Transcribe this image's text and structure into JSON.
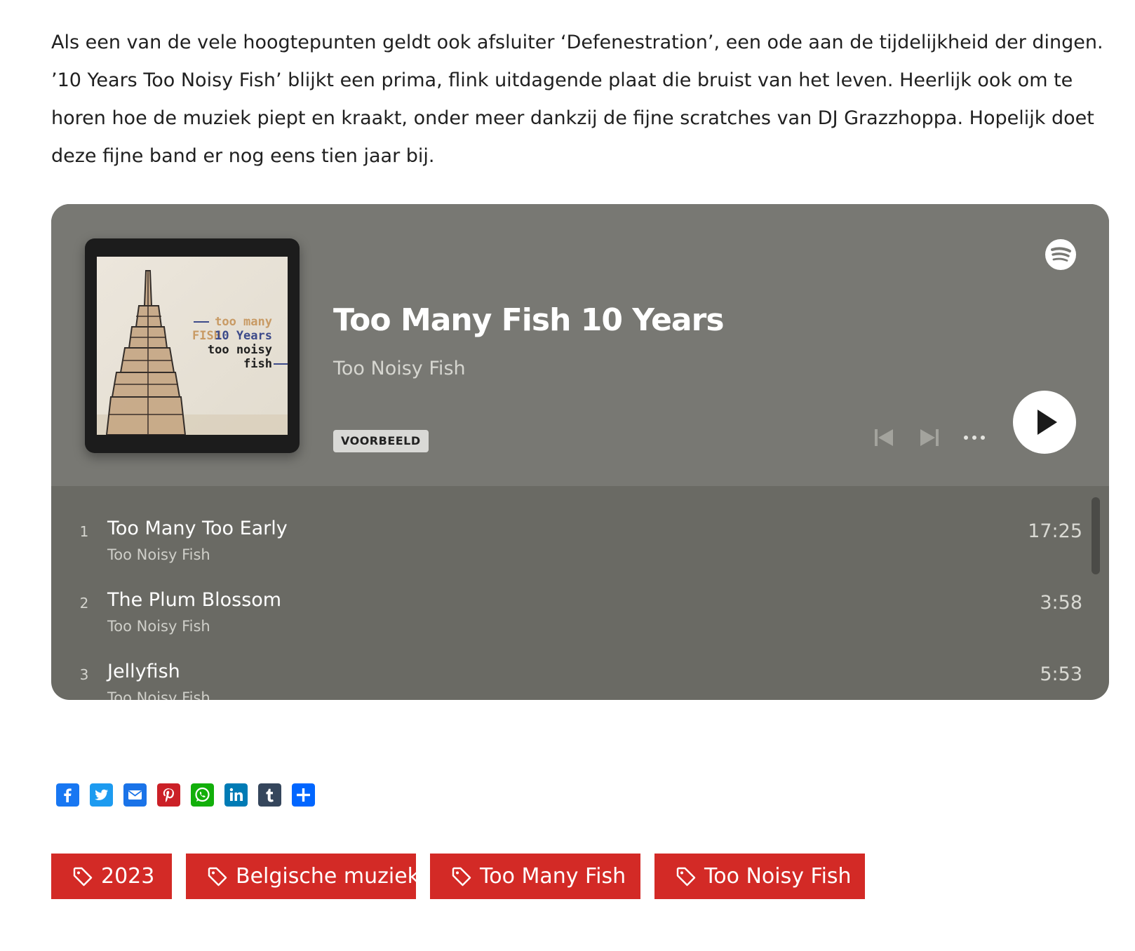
{
  "article": {
    "paragraph": "Als een van de vele hoogtepunten geldt ook afsluiter ‘Defenestration’, een ode aan de tijdelijkheid der dingen. ’10 Years Too Noisy Fish’ blijkt een prima, flink uitdagende plaat die bruist van het leven. Heerlijk ook om te horen hoe de muziek piept en kraakt, onder meer dankzij de fijne scratches van DJ Grazzhoppa. Hopelijk doet deze fijne band er nog eens tien jaar bij."
  },
  "player": {
    "album_title": "Too Many Fish 10 Years",
    "artist": "Too Noisy Fish",
    "preview_label": "VOORBEELD",
    "cover_text": {
      "line1": "too many",
      "line2a": "FISH",
      "line2b": "10 Years",
      "line3": "too noisy",
      "line4": "fish"
    },
    "colors": {
      "header_bg": "#787873",
      "list_bg": "#6a6a64"
    },
    "tracks": [
      {
        "number": "1",
        "title": "Too Many Too Early",
        "artist": "Too Noisy Fish",
        "duration": "17:25"
      },
      {
        "number": "2",
        "title": "The Plum Blossom",
        "artist": "Too Noisy Fish",
        "duration": "3:58"
      },
      {
        "number": "3",
        "title": "Jellyfish",
        "artist": "Too Noisy Fish",
        "duration": "5:53"
      }
    ]
  },
  "share": {
    "icons": [
      "facebook-icon",
      "twitter-icon",
      "email-icon",
      "pinterest-icon",
      "whatsapp-icon",
      "linkedin-icon",
      "tumblr-icon",
      "add-share-icon"
    ]
  },
  "tags": [
    {
      "label": "2023"
    },
    {
      "label": "Belgische muziek"
    },
    {
      "label": "Too Many Fish"
    },
    {
      "label": "Too Noisy Fish"
    }
  ],
  "brand_colors": {
    "tag_red": "#d32a26"
  }
}
